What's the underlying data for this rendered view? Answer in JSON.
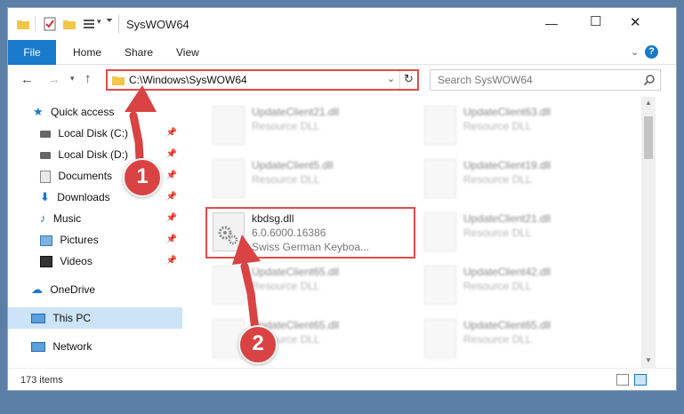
{
  "window": {
    "title": "SysWOW64",
    "controls": {
      "minimize": "—",
      "maximize": "☐",
      "close": "✕"
    }
  },
  "ribbon": {
    "tabs": [
      "File",
      "Home",
      "Share",
      "View"
    ],
    "expand_icon": "chevron-down-icon",
    "help_icon": "help-icon"
  },
  "nav": {
    "path": "C:\\Windows\\SysWOW64",
    "search_placeholder": "Search SysWOW64"
  },
  "sidebar": {
    "items": [
      {
        "label": "Quick access",
        "icon": "star-icon",
        "pinned": false
      },
      {
        "label": "Local Disk (C:)",
        "icon": "drive-icon",
        "pinned": true
      },
      {
        "label": "Local Disk (D:)",
        "icon": "drive-icon",
        "pinned": true
      },
      {
        "label": "Documents",
        "icon": "documents-icon",
        "pinned": true
      },
      {
        "label": "Downloads",
        "icon": "downloads-icon",
        "pinned": true
      },
      {
        "label": "Music",
        "icon": "music-icon",
        "pinned": true
      },
      {
        "label": "Pictures",
        "icon": "pictures-icon",
        "pinned": true
      },
      {
        "label": "Videos",
        "icon": "videos-icon",
        "pinned": true
      },
      {
        "label": "OneDrive",
        "icon": "cloud-icon",
        "pinned": false
      },
      {
        "label": "This PC",
        "icon": "computer-icon",
        "pinned": false,
        "selected": true
      },
      {
        "label": "Network",
        "icon": "network-icon",
        "pinned": false
      }
    ]
  },
  "files": {
    "left": [
      {
        "name": "UpdateClient21.dll",
        "desc": "Resource DLL"
      },
      {
        "name": "UpdateClient5.dll",
        "desc": "Resource DLL"
      },
      {
        "name": "kbdsg.dll",
        "version": "6.0.6000.16386",
        "desc": "Swiss German Keyboa...",
        "highlighted": true
      },
      {
        "name": "UpdateClient65.dll",
        "desc": "Resource DLL"
      },
      {
        "name": "UpdateClient65.dll",
        "desc": "Resource DLL"
      }
    ],
    "right": [
      {
        "name": "UpdateClient63.dll",
        "desc": "Resource DLL"
      },
      {
        "name": "UpdateClient19.dll",
        "desc": "Resource DLL"
      },
      {
        "name": "UpdateClient21.dll",
        "desc": "Resource DLL"
      },
      {
        "name": "UpdateClient42.dll",
        "desc": "Resource DLL"
      },
      {
        "name": "UpdateClient65.dll",
        "desc": "Resource DLL"
      }
    ]
  },
  "status": {
    "count": "173 items"
  },
  "annotations": {
    "badge1": "1",
    "badge2": "2"
  },
  "colors": {
    "accent": "#1979ca",
    "highlight": "#e04c4c",
    "selected": "#cce4f7"
  }
}
